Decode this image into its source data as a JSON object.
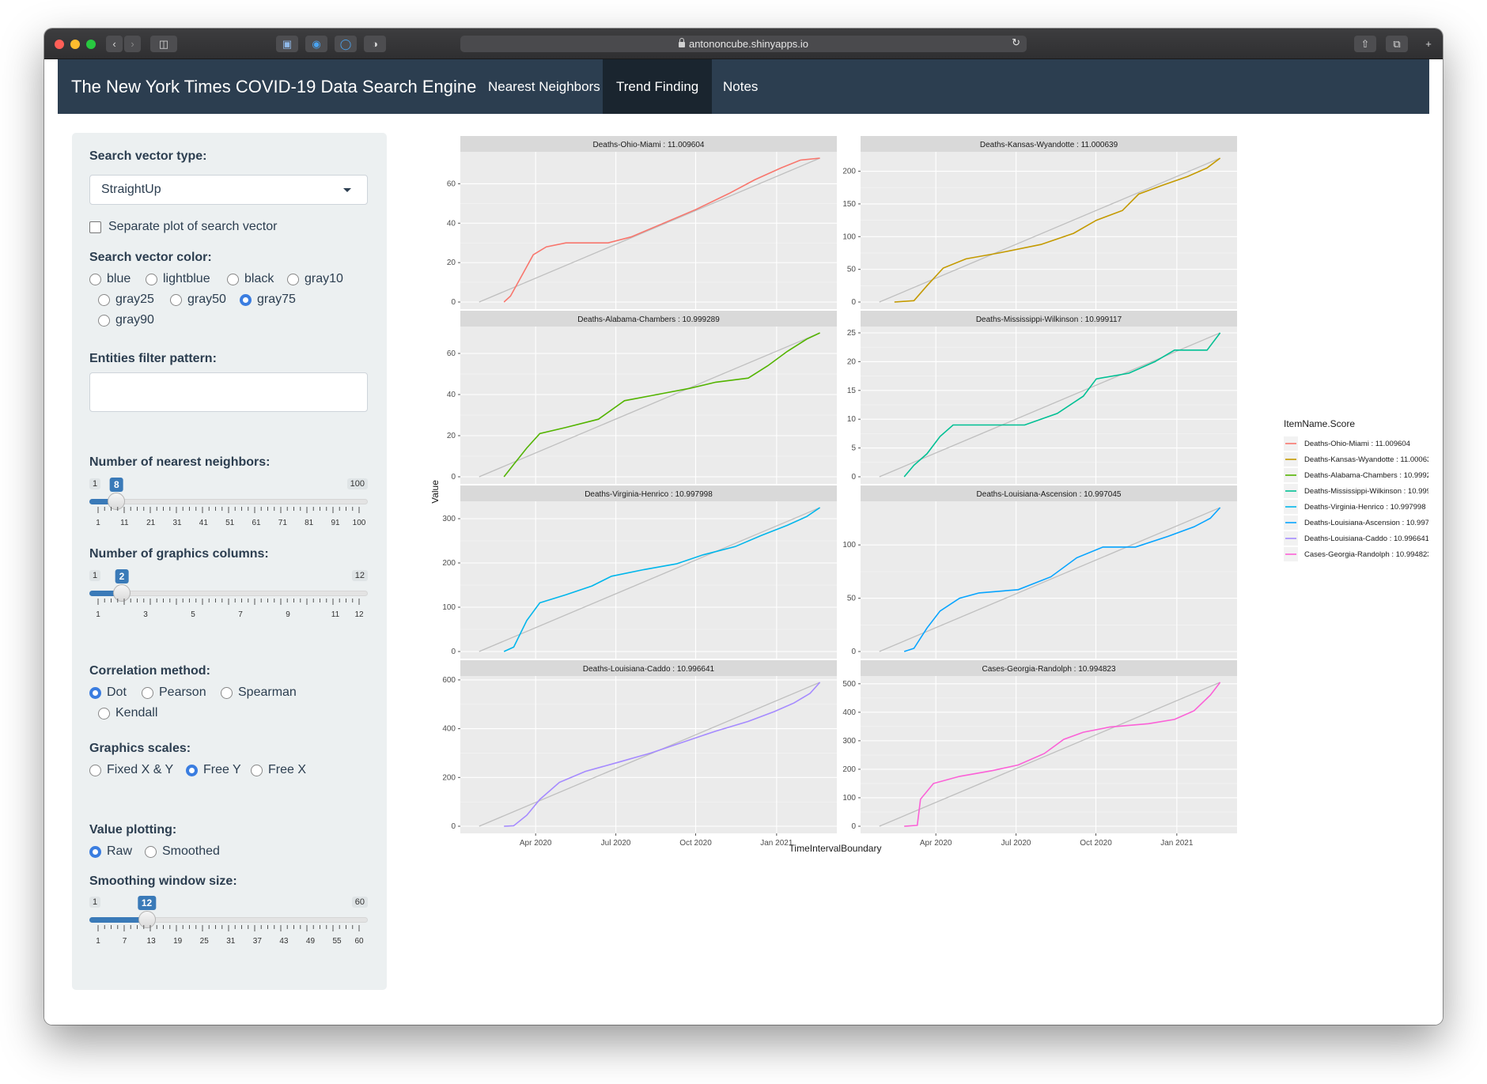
{
  "browser": {
    "url": "antononcube.shinyapps.io"
  },
  "navbar": {
    "brand": "The New York Times COVID-19 Data Search Engine",
    "tabs": [
      {
        "label": "Nearest Neighbors",
        "active": false
      },
      {
        "label": "Trend Finding",
        "active": true
      },
      {
        "label": "Notes",
        "active": false
      }
    ]
  },
  "sidebar": {
    "search_vector_type": {
      "label": "Search vector type:",
      "value": "StraightUp"
    },
    "separate_plot": {
      "label": "Separate plot of search vector",
      "checked": false
    },
    "search_vector_color": {
      "label": "Search vector color:",
      "options": [
        "blue",
        "lightblue",
        "black",
        "gray10",
        "gray25",
        "gray50",
        "gray75",
        "gray90"
      ],
      "selected": "gray75"
    },
    "entities_filter": {
      "label": "Entities filter pattern:",
      "value": ""
    },
    "nearest_neighbors": {
      "label": "Number of nearest neighbors:",
      "min": 1,
      "max": 100,
      "value": 8,
      "tick_labels": [
        "1",
        "11",
        "21",
        "31",
        "41",
        "51",
        "61",
        "71",
        "81",
        "91",
        "100"
      ]
    },
    "graphics_columns": {
      "label": "Number of graphics columns:",
      "min": 1,
      "max": 12,
      "value": 2,
      "tick_labels": [
        "1",
        "3",
        "5",
        "7",
        "9",
        "11",
        "12"
      ]
    },
    "correlation_method": {
      "label": "Correlation method:",
      "options": [
        "Dot",
        "Pearson",
        "Spearman",
        "Kendall"
      ],
      "selected": "Dot"
    },
    "graphics_scales": {
      "label": "Graphics scales:",
      "options": [
        "Fixed X & Y",
        "Free Y",
        "Free X"
      ],
      "selected": "Free Y"
    },
    "value_plotting": {
      "label": "Value plotting:",
      "options": [
        "Raw",
        "Smoothed"
      ],
      "selected": "Raw"
    },
    "smoothing_window": {
      "label": "Smoothing window size:",
      "min": 1,
      "max": 60,
      "value": 12,
      "tick_labels": [
        "1",
        "7",
        "13",
        "19",
        "25",
        "31",
        "37",
        "43",
        "49",
        "55",
        "60"
      ]
    }
  },
  "chart_data": {
    "type": "line",
    "xlabel": "TimeIntervalBoundary",
    "ylabel": "Value",
    "x_tick_labels": [
      "Apr 2020",
      "Jul 2020",
      "Oct 2020",
      "Jan 2021"
    ],
    "legend": {
      "title": "ItemName.Score",
      "placement": "right"
    },
    "reference_line_color": "#bfbfbf",
    "panels": [
      {
        "title": "Deaths-Ohio-Miami : 11.009604",
        "name": "Deaths-Ohio-Miami : 11.009604",
        "color": "#F8766D",
        "yticks": [
          0,
          20,
          40,
          60
        ],
        "ymax": 73,
        "trend": [
          [
            0.03,
            0
          ],
          [
            0.05,
            3
          ],
          [
            0.09,
            15
          ],
          [
            0.12,
            24
          ],
          [
            0.16,
            28
          ],
          [
            0.22,
            30
          ],
          [
            0.35,
            30
          ],
          [
            0.42,
            33
          ],
          [
            0.52,
            40
          ],
          [
            0.62,
            47
          ],
          [
            0.72,
            55
          ],
          [
            0.8,
            62
          ],
          [
            0.88,
            68
          ],
          [
            0.94,
            72
          ],
          [
            1.0,
            73
          ]
        ]
      },
      {
        "title": "Deaths-Kansas-Wyandotte : 11.000639",
        "name": "Deaths-Kansas-Wyandotte : 11.000639",
        "color": "#C49A00",
        "yticks": [
          0,
          50,
          100,
          150,
          200
        ],
        "ymax": 220,
        "trend": [
          [
            0.0,
            0
          ],
          [
            0.06,
            2
          ],
          [
            0.1,
            25
          ],
          [
            0.15,
            52
          ],
          [
            0.22,
            66
          ],
          [
            0.32,
            75
          ],
          [
            0.45,
            88
          ],
          [
            0.55,
            105
          ],
          [
            0.62,
            125
          ],
          [
            0.7,
            140
          ],
          [
            0.75,
            165
          ],
          [
            0.82,
            178
          ],
          [
            0.9,
            192
          ],
          [
            0.96,
            205
          ],
          [
            1.0,
            220
          ]
        ]
      },
      {
        "title": "Deaths-Alabama-Chambers : 10.999289",
        "name": "Deaths-Alabama-Chambers : 10.999289",
        "color": "#53B400",
        "yticks": [
          0,
          20,
          40,
          60
        ],
        "ymax": 70,
        "trend": [
          [
            0.03,
            0
          ],
          [
            0.06,
            6
          ],
          [
            0.1,
            14
          ],
          [
            0.14,
            21
          ],
          [
            0.22,
            24
          ],
          [
            0.32,
            28
          ],
          [
            0.4,
            37
          ],
          [
            0.5,
            40
          ],
          [
            0.6,
            43
          ],
          [
            0.68,
            46
          ],
          [
            0.78,
            48
          ],
          [
            0.84,
            54
          ],
          [
            0.9,
            61
          ],
          [
            0.96,
            67
          ],
          [
            1.0,
            70
          ]
        ]
      },
      {
        "title": "Deaths-Mississippi-Wilkinson : 10.999117",
        "name": "Deaths-Mississippi-Wilkinson : 10.999117",
        "color": "#00C094",
        "yticks": [
          0,
          5,
          10,
          15,
          20,
          25
        ],
        "ymax": 25,
        "trend": [
          [
            0.03,
            0
          ],
          [
            0.06,
            2
          ],
          [
            0.1,
            4
          ],
          [
            0.14,
            7
          ],
          [
            0.18,
            9
          ],
          [
            0.4,
            9
          ],
          [
            0.5,
            11
          ],
          [
            0.58,
            14
          ],
          [
            0.62,
            17
          ],
          [
            0.72,
            18
          ],
          [
            0.8,
            20
          ],
          [
            0.86,
            22
          ],
          [
            0.96,
            22
          ],
          [
            1.0,
            25
          ]
        ]
      },
      {
        "title": "Deaths-Virginia-Henrico : 10.997998",
        "name": "Deaths-Virginia-Henrico : 10.997998",
        "color": "#00B6EB",
        "yticks": [
          0,
          100,
          200,
          300
        ],
        "ymax": 325,
        "trend": [
          [
            0.03,
            0
          ],
          [
            0.06,
            10
          ],
          [
            0.1,
            70
          ],
          [
            0.14,
            110
          ],
          [
            0.22,
            128
          ],
          [
            0.3,
            148
          ],
          [
            0.36,
            170
          ],
          [
            0.46,
            185
          ],
          [
            0.56,
            198
          ],
          [
            0.64,
            218
          ],
          [
            0.74,
            237
          ],
          [
            0.82,
            262
          ],
          [
            0.9,
            285
          ],
          [
            0.96,
            305
          ],
          [
            1.0,
            325
          ]
        ]
      },
      {
        "title": "Deaths-Louisiana-Ascension : 10.997045",
        "name": "Deaths-Louisiana-Ascension : 10.997045",
        "color": "#06A4FF",
        "yticks": [
          0,
          50,
          100
        ],
        "ymax": 135,
        "trend": [
          [
            0.03,
            0
          ],
          [
            0.06,
            3
          ],
          [
            0.1,
            22
          ],
          [
            0.14,
            38
          ],
          [
            0.2,
            50
          ],
          [
            0.26,
            55
          ],
          [
            0.38,
            58
          ],
          [
            0.48,
            70
          ],
          [
            0.56,
            88
          ],
          [
            0.64,
            98
          ],
          [
            0.74,
            98
          ],
          [
            0.84,
            108
          ],
          [
            0.92,
            117
          ],
          [
            0.97,
            125
          ],
          [
            1.0,
            135
          ]
        ]
      },
      {
        "title": "Deaths-Louisiana-Caddo : 10.996641",
        "name": "Deaths-Louisiana-Caddo : 10.996641",
        "color": "#A58AFF",
        "yticks": [
          0,
          200,
          400,
          600
        ],
        "ymax": 590,
        "trend": [
          [
            0.03,
            0
          ],
          [
            0.06,
            2
          ],
          [
            0.1,
            45
          ],
          [
            0.14,
            110
          ],
          [
            0.2,
            180
          ],
          [
            0.28,
            225
          ],
          [
            0.38,
            262
          ],
          [
            0.48,
            300
          ],
          [
            0.58,
            345
          ],
          [
            0.68,
            390
          ],
          [
            0.78,
            430
          ],
          [
            0.86,
            470
          ],
          [
            0.92,
            505
          ],
          [
            0.97,
            545
          ],
          [
            1.0,
            590
          ]
        ]
      },
      {
        "title": "Cases-Georgia-Randolph : 10.994823",
        "name": "Cases-Georgia-Randolph : 10.994823",
        "color": "#FB61D7",
        "yticks": [
          0,
          100,
          200,
          300,
          400,
          500
        ],
        "ymax": 505,
        "trend": [
          [
            0.03,
            0
          ],
          [
            0.07,
            3
          ],
          [
            0.08,
            95
          ],
          [
            0.12,
            150
          ],
          [
            0.2,
            175
          ],
          [
            0.3,
            195
          ],
          [
            0.38,
            215
          ],
          [
            0.46,
            255
          ],
          [
            0.52,
            305
          ],
          [
            0.58,
            330
          ],
          [
            0.66,
            348
          ],
          [
            0.78,
            360
          ],
          [
            0.86,
            375
          ],
          [
            0.92,
            405
          ],
          [
            0.97,
            460
          ],
          [
            1.0,
            505
          ]
        ]
      }
    ]
  }
}
